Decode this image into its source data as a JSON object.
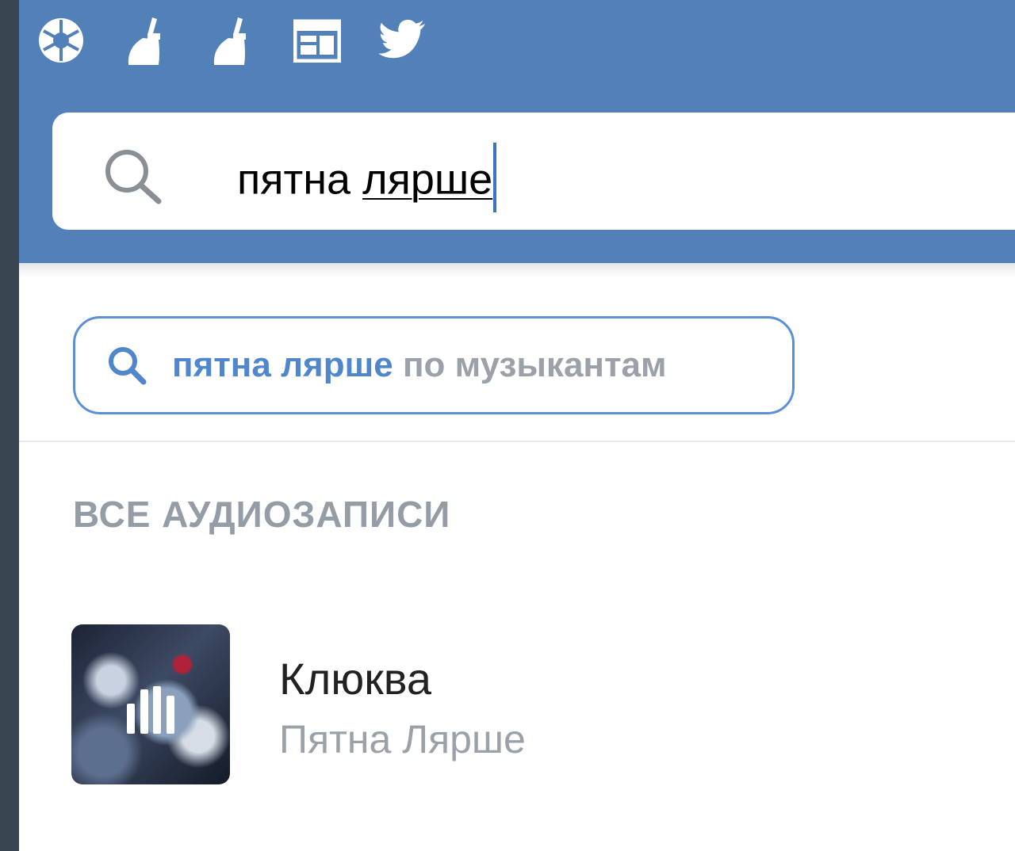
{
  "toolbar": {
    "icons": [
      "camera-shutter-icon",
      "broom-icon",
      "broom-icon",
      "calendar-icon",
      "twitter-icon"
    ]
  },
  "search": {
    "query_plain": "пятна ",
    "query_underlined": "лярше"
  },
  "suggestion": {
    "query": "пятна лярше",
    "suffix": " по музыкантам"
  },
  "section": {
    "title": "ВСЕ АУДИОЗАПИСИ"
  },
  "track": {
    "title": "Клюква",
    "artist": "Пятна Лярше"
  },
  "colors": {
    "header_bg": "#5181b8",
    "accent": "#4f86cc",
    "muted_text": "#9aa1a9"
  }
}
